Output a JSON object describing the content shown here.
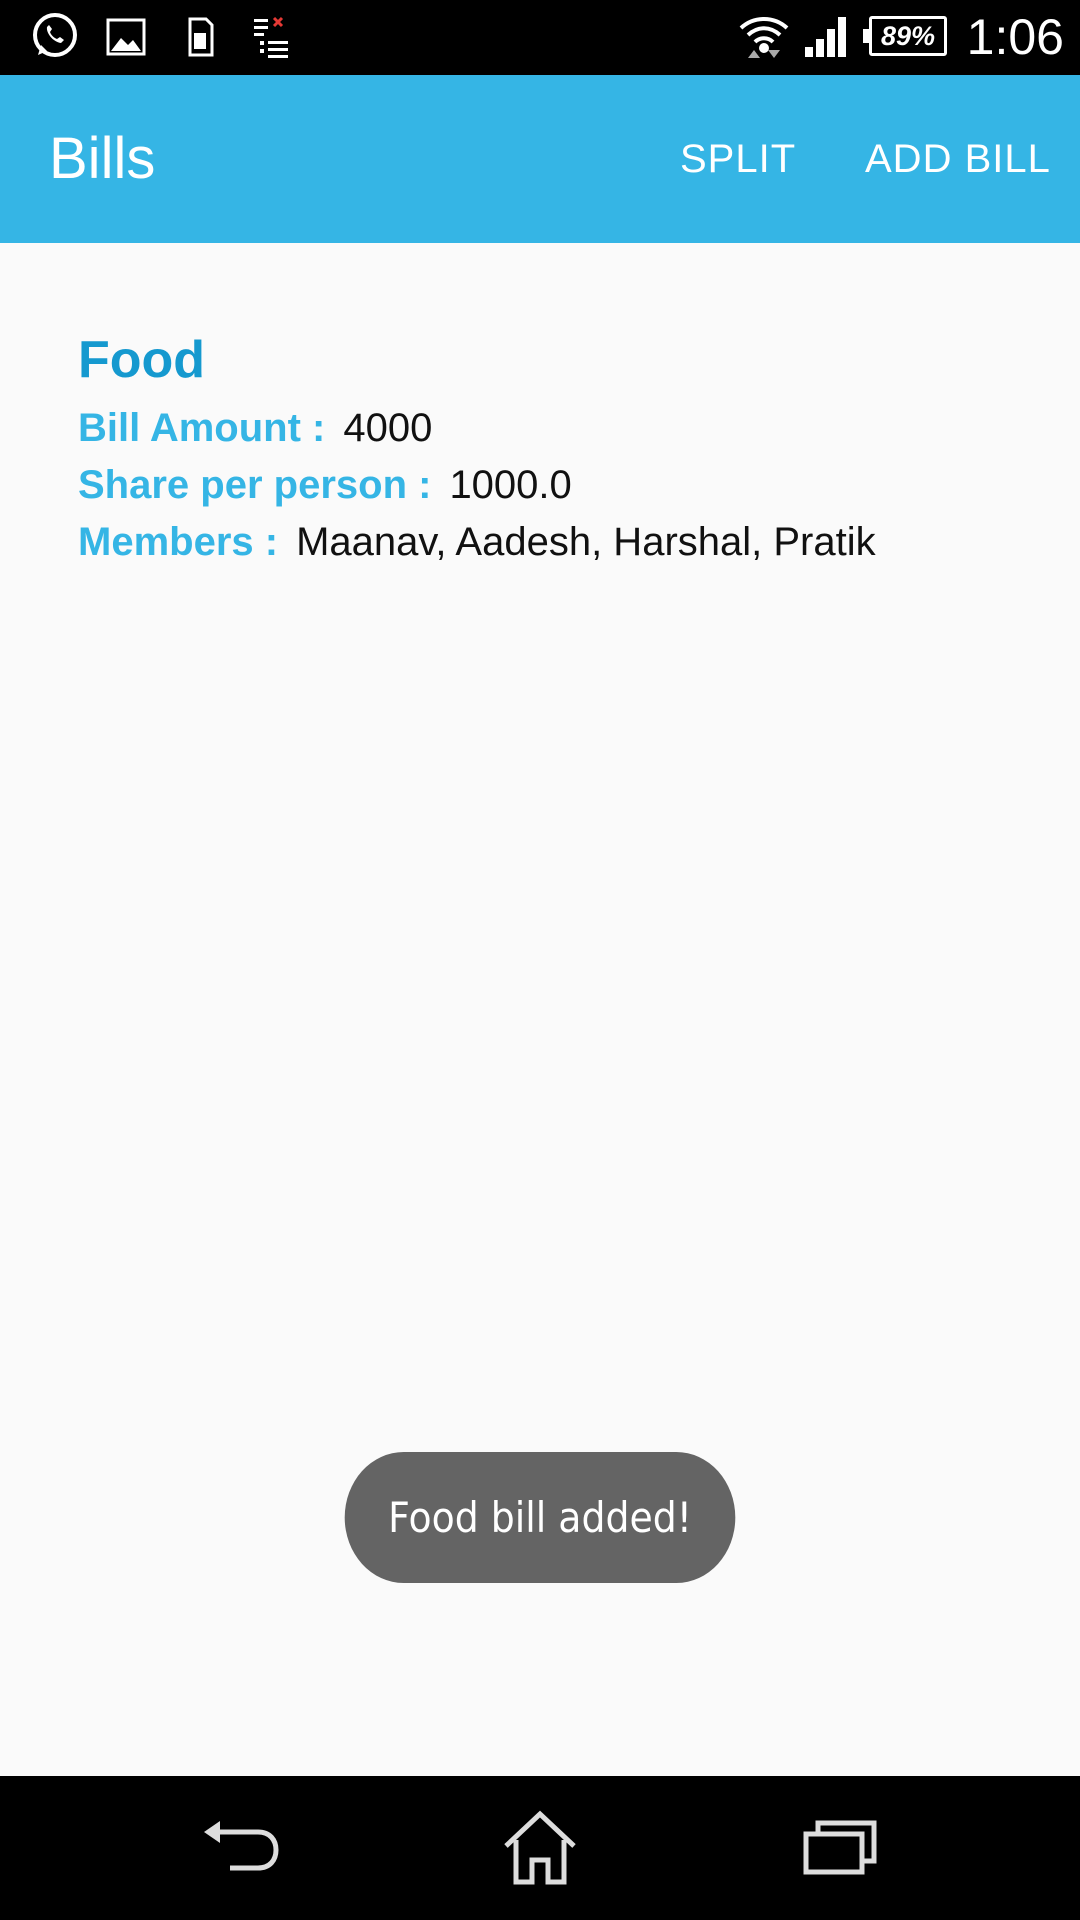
{
  "status_bar": {
    "battery": "89%",
    "time": "1:06",
    "icons": [
      "whatsapp-icon",
      "gallery-icon",
      "sd-card-icon",
      "download-error-icon",
      "wifi-icon",
      "signal-icon",
      "battery-icon"
    ]
  },
  "app_bar": {
    "title": "Bills",
    "actions": {
      "split": "SPLIT",
      "add_bill": "ADD BILL"
    },
    "color": "#35b5e5"
  },
  "bill": {
    "title": "Food",
    "amount_label": "Bill Amount :",
    "amount_value": "4000",
    "share_label": "Share per person :",
    "share_value": "1000.0",
    "members_label": "Members :",
    "members_value": "Maanav, Aadesh, Harshal, Pratik"
  },
  "toast": {
    "message": "Food bill added!"
  },
  "nav_bar": {
    "icons": [
      "back-icon",
      "home-icon",
      "recents-icon"
    ]
  }
}
